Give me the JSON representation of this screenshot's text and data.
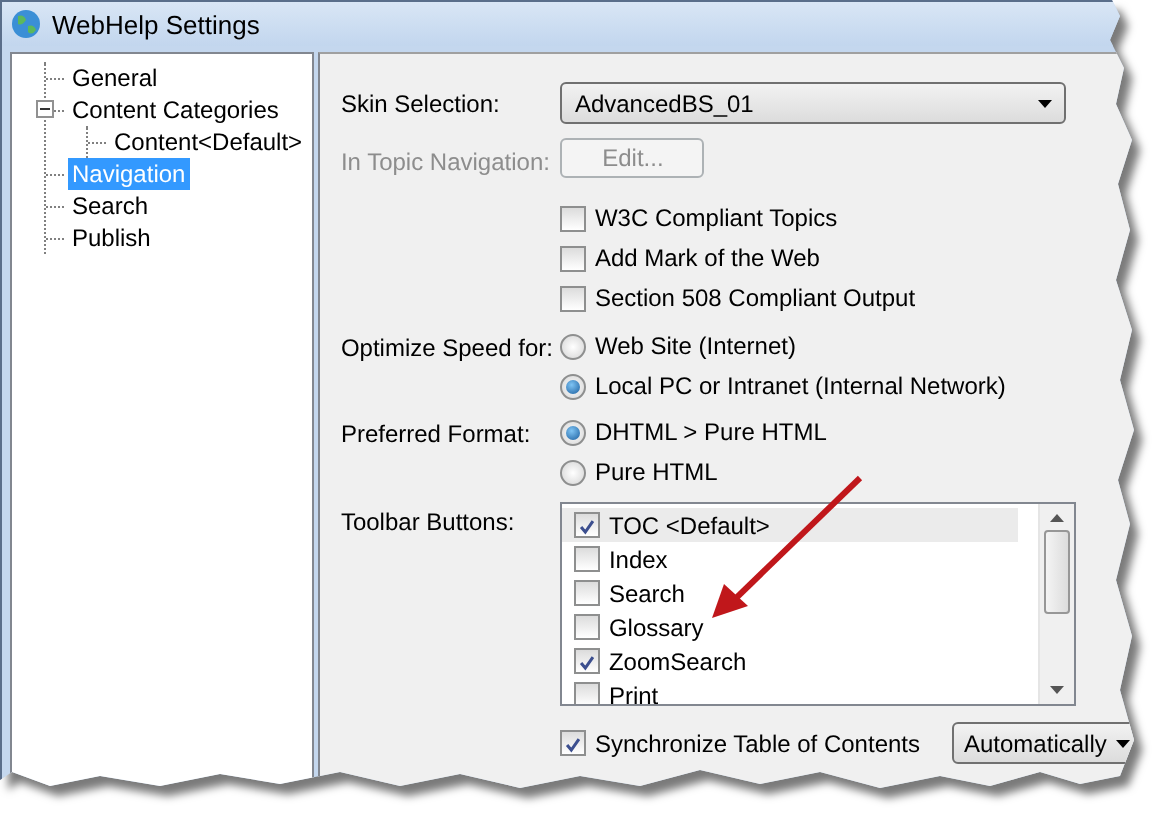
{
  "window": {
    "title": "WebHelp Settings"
  },
  "tree": [
    {
      "label": "General",
      "selected": false
    },
    {
      "label": "Content Categories",
      "selected": false,
      "expanded": true,
      "children": [
        {
          "label": "Content<Default>",
          "selected": false
        }
      ]
    },
    {
      "label": "Navigation",
      "selected": true
    },
    {
      "label": "Search",
      "selected": false
    },
    {
      "label": "Publish",
      "selected": false
    }
  ],
  "form": {
    "skin_selection": {
      "label": "Skin Selection:",
      "value": "AdvancedBS_01"
    },
    "in_topic_navigation": {
      "label": "In Topic Navigation:",
      "button": "Edit...",
      "disabled": true
    },
    "options": [
      {
        "label": "W3C Compliant Topics",
        "checked": false
      },
      {
        "label": "Add Mark of the Web",
        "checked": false
      },
      {
        "label": "Section 508 Compliant Output",
        "checked": false
      }
    ],
    "optimize_speed": {
      "label": "Optimize Speed for:",
      "options": [
        {
          "label": "Web Site (Internet)",
          "selected": false
        },
        {
          "label": "Local PC or Intranet (Internal Network)",
          "selected": true
        }
      ]
    },
    "preferred_format": {
      "label": "Preferred Format:",
      "options": [
        {
          "label": "DHTML > Pure HTML",
          "selected": true
        },
        {
          "label": "Pure HTML",
          "selected": false
        }
      ]
    },
    "toolbar_buttons": {
      "label": "Toolbar Buttons:",
      "items": [
        {
          "label": "TOC <Default>",
          "checked": true,
          "selected": true
        },
        {
          "label": "Index",
          "checked": false,
          "selected": false
        },
        {
          "label": "Search",
          "checked": false,
          "selected": false
        },
        {
          "label": "Glossary",
          "checked": false,
          "selected": false
        },
        {
          "label": "ZoomSearch",
          "checked": true,
          "selected": false
        },
        {
          "label": "Print",
          "checked": false,
          "selected": false
        }
      ]
    },
    "synchronize_toc": {
      "label": "Synchronize Table of Contents",
      "checked": true,
      "value": "Automatically"
    }
  }
}
